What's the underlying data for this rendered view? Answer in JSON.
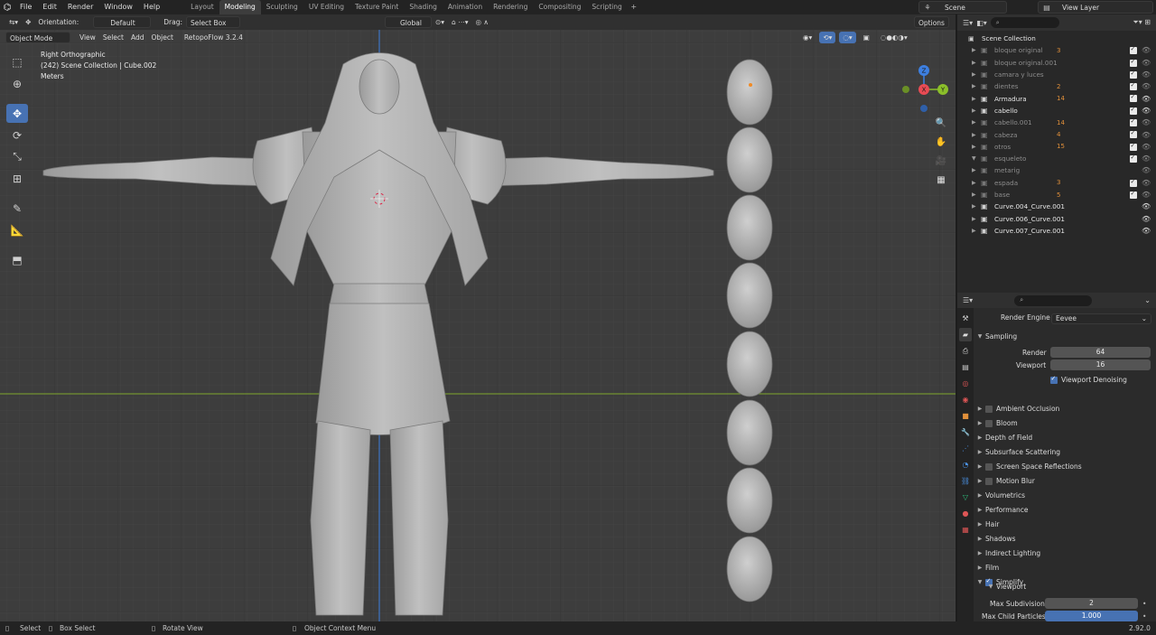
{
  "menu": {
    "items": [
      "File",
      "Edit",
      "Render",
      "Window",
      "Help"
    ],
    "workspaces": [
      "Layout",
      "Modeling",
      "Sculpting",
      "UV Editing",
      "Texture Paint",
      "Shading",
      "Animation",
      "Rendering",
      "Compositing",
      "Scripting"
    ],
    "active_workspace": "Modeling",
    "scene": "Scene",
    "view_layer": "View Layer"
  },
  "viewport": {
    "header": {
      "orientation_label": "Orientation:",
      "orientation_value": "Default",
      "drag_label": "Drag:",
      "drag_value": "Select Box",
      "transform_space": "Global",
      "options": "Options"
    },
    "header2": {
      "mode": "Object Mode",
      "view": "View",
      "select": "Select",
      "add": "Add",
      "object": "Object",
      "addon": "RetopoFlow 3.2.4"
    },
    "hud": {
      "view_name": "Right Orthographic",
      "collection": "(242) Scene Collection | Cube.002",
      "units": "Meters"
    },
    "tools": [
      "select-box",
      "cursor",
      "move",
      "rotate",
      "scale",
      "transform",
      "annotate",
      "measure",
      "add-cube"
    ],
    "active_tool": "move",
    "gizmo_axes": {
      "x": "X",
      "y": "Y",
      "z": "Z"
    },
    "colors": {
      "axis_x": "#e84b54",
      "axis_y": "#8bbf2a",
      "axis_z": "#3d7fe0",
      "grid_bg": "#3d3d3d",
      "mesh": "#b3b3b3"
    }
  },
  "outliner": {
    "root": "Scene Collection",
    "items": [
      {
        "name": "bloque original",
        "badge": "3",
        "dim": true,
        "check": true,
        "expanded": false
      },
      {
        "name": "bloque original.001",
        "badge": "",
        "dim": true,
        "check": true,
        "expanded": false
      },
      {
        "name": "camara y luces",
        "badge": "",
        "dim": true,
        "check": true,
        "expanded": false
      },
      {
        "name": "dientes",
        "badge": "2",
        "dim": true,
        "check": true,
        "expanded": false
      },
      {
        "name": "Armadura",
        "badge": "14",
        "dim": false,
        "check": true,
        "expanded": false
      },
      {
        "name": "cabello",
        "badge": "",
        "dim": false,
        "check": true,
        "expanded": false
      },
      {
        "name": "cabello.001",
        "badge": "14",
        "dim": true,
        "check": true,
        "expanded": false
      },
      {
        "name": "cabeza",
        "badge": "4",
        "dim": true,
        "check": true,
        "expanded": false
      },
      {
        "name": "otros",
        "badge": "15",
        "dim": true,
        "check": true,
        "expanded": false
      },
      {
        "name": "esqueleto",
        "badge": "",
        "dim": true,
        "check": true,
        "expanded": true
      },
      {
        "name": "metarig",
        "badge": "",
        "dim": true,
        "check": false,
        "expanded": false
      },
      {
        "name": "espada",
        "badge": "3",
        "dim": true,
        "check": true,
        "expanded": false
      },
      {
        "name": "base",
        "badge": "5",
        "dim": true,
        "check": true,
        "expanded": false
      },
      {
        "name": "Curve.004_Curve.001",
        "badge": "",
        "dim": false,
        "check": false,
        "expanded": false
      },
      {
        "name": "Curve.006_Curve.001",
        "badge": "",
        "dim": false,
        "check": false,
        "expanded": false
      },
      {
        "name": "Curve.007_Curve.001",
        "badge": "",
        "dim": false,
        "check": false,
        "expanded": false
      }
    ]
  },
  "properties": {
    "render_engine_label": "Render Engine",
    "render_engine": "Eevee",
    "sampling": {
      "title": "Sampling",
      "render_label": "Render",
      "render_value": "64",
      "viewport_label": "Viewport",
      "viewport_value": "16",
      "denoise_label": "Viewport Denoising"
    },
    "panels": [
      {
        "label": "Ambient Occlusion",
        "checkbox": true,
        "on": false
      },
      {
        "label": "Bloom",
        "checkbox": true,
        "on": false
      },
      {
        "label": "Depth of Field",
        "checkbox": false,
        "on": false
      },
      {
        "label": "Subsurface Scattering",
        "checkbox": false,
        "on": false
      },
      {
        "label": "Screen Space Reflections",
        "checkbox": true,
        "on": false
      },
      {
        "label": "Motion Blur",
        "checkbox": true,
        "on": false
      },
      {
        "label": "Volumetrics",
        "checkbox": false,
        "on": false
      },
      {
        "label": "Performance",
        "checkbox": false,
        "on": false
      },
      {
        "label": "Hair",
        "checkbox": false,
        "on": false
      },
      {
        "label": "Shadows",
        "checkbox": false,
        "on": false
      },
      {
        "label": "Indirect Lighting",
        "checkbox": false,
        "on": false
      },
      {
        "label": "Film",
        "checkbox": false,
        "on": false
      },
      {
        "label": "Simplify",
        "checkbox": true,
        "on": true
      }
    ],
    "simplify": {
      "subpanel": "Viewport",
      "max_subdiv_label": "Max Subdivision",
      "max_subdiv_value": "2",
      "max_child_label": "Max Child Particles",
      "max_child_value": "1.000"
    }
  },
  "statusbar": {
    "select": "Select",
    "box_select": "Box Select",
    "rotate_view": "Rotate View",
    "context_menu": "Object Context Menu",
    "version": "2.92.0"
  }
}
